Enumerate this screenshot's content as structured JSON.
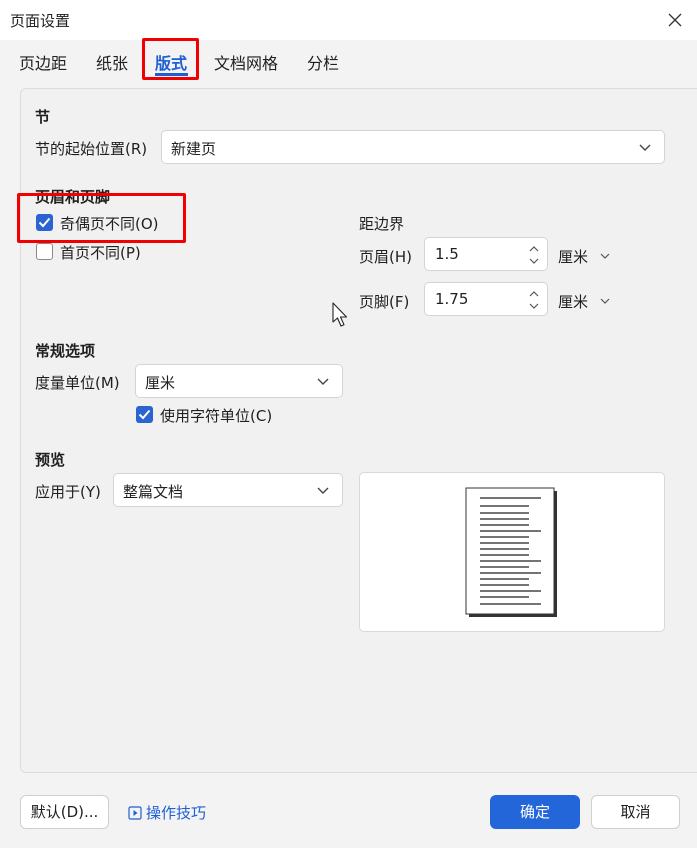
{
  "window": {
    "title": "页面设置"
  },
  "tabs": [
    {
      "label": "页边距"
    },
    {
      "label": "纸张"
    },
    {
      "label": "版式"
    },
    {
      "label": "文档网格"
    },
    {
      "label": "分栏"
    }
  ],
  "section": {
    "heading": "节",
    "start_label": "节的起始位置(R)",
    "start_value": "新建页"
  },
  "header_footer": {
    "heading": "页眉和页脚",
    "odd_even_label": "奇偶页不同(O)",
    "odd_even_checked": true,
    "first_page_label": "首页不同(P)",
    "first_page_checked": false,
    "distance_heading": "距边界",
    "header_label": "页眉(H)",
    "header_value": "1.5",
    "header_unit": "厘米",
    "footer_label": "页脚(F)",
    "footer_value": "1.75",
    "footer_unit": "厘米"
  },
  "general": {
    "heading": "常规选项",
    "unit_label": "度量单位(M)",
    "unit_value": "厘米",
    "char_unit_label": "使用字符单位(C)",
    "char_unit_checked": true
  },
  "preview": {
    "heading": "预览",
    "apply_label": "应用于(Y)",
    "apply_value": "整篇文档"
  },
  "footer": {
    "default_button": "默认(D)...",
    "tips_link": "操作技巧",
    "ok_button": "确定",
    "cancel_button": "取消"
  },
  "colors": {
    "accent": "#2366d9",
    "highlight_box": "#f00000"
  },
  "icons": [
    "close-icon",
    "chevron-down-icon",
    "checkmark-icon",
    "spinner-arrows-icon",
    "play-icon",
    "mouse-cursor-icon"
  ]
}
